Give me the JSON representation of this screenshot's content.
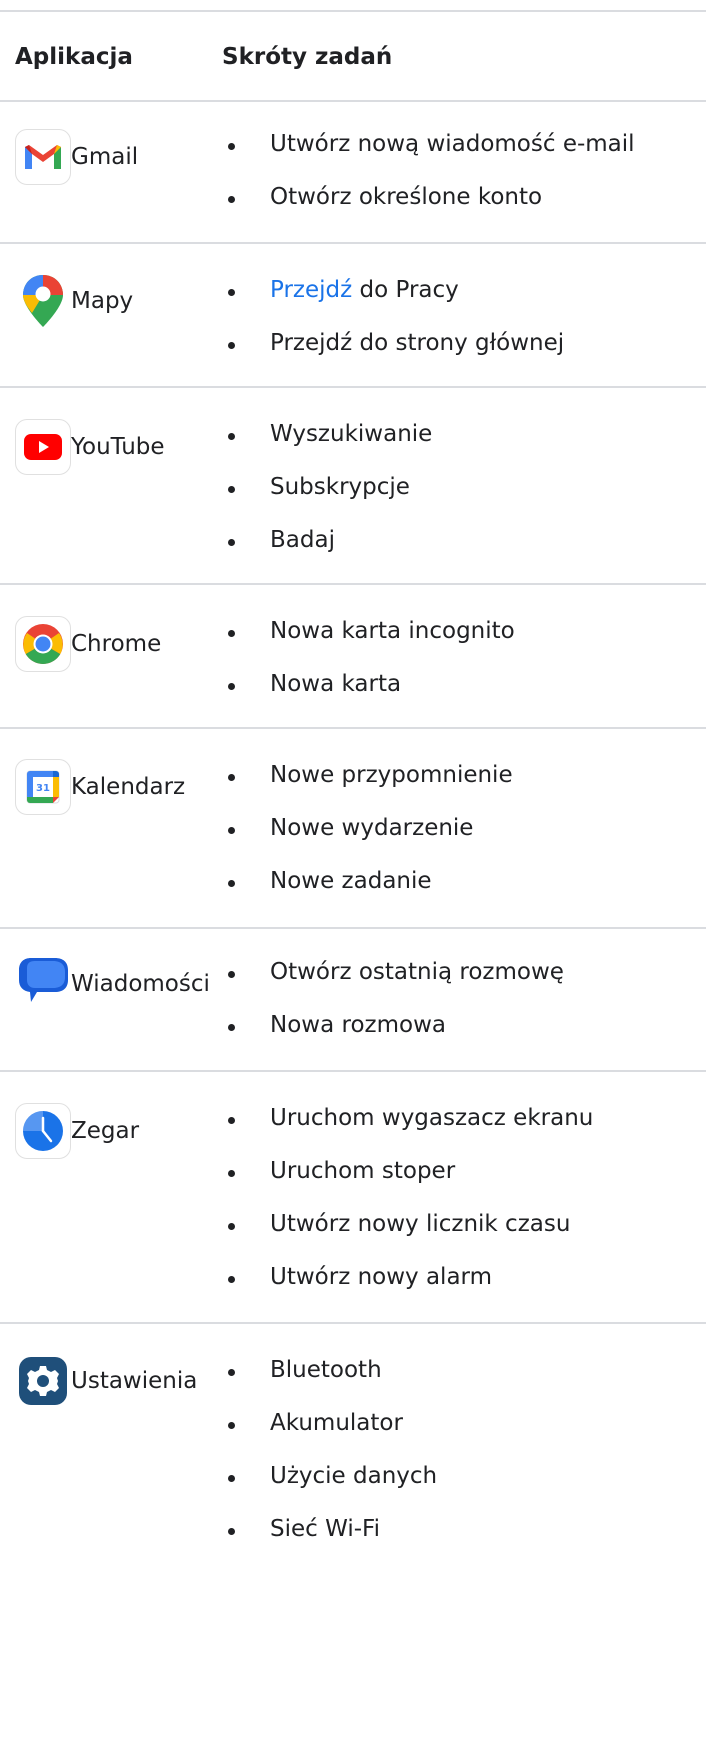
{
  "table": {
    "header": {
      "app_col": "Aplikacja",
      "shortcuts_col": "Skróty zadań"
    },
    "rows": [
      {
        "app": "Gmail",
        "icon": "gmail-icon",
        "shortcuts": [
          "Utwórz nową wiadomość e-mail",
          "Otwórz określone konto"
        ]
      },
      {
        "app": "Mapy",
        "icon": "maps-icon",
        "shortcuts": [
          "Przejdź",
          " do Pracy",
          "Przejdź do strony głównej"
        ],
        "link_word": "Przejdź",
        "link_rest": " do Pracy"
      },
      {
        "app": "YouTube",
        "icon": "youtube-icon",
        "shortcuts": [
          "Wyszukiwanie",
          "Subskrypcje",
          "Badaj"
        ]
      },
      {
        "app": "Chrome",
        "icon": "chrome-icon",
        "shortcuts": [
          "Nowa karta incognito",
          "Nowa karta"
        ]
      },
      {
        "app": "Kalendarz",
        "icon": "calendar-icon",
        "calendar_day": "31",
        "shortcuts": [
          "Nowe przypomnienie",
          "Nowe wydarzenie",
          "Nowe zadanie"
        ]
      },
      {
        "app": "Wiadomości",
        "icon": "messages-icon",
        "shortcuts": [
          "Otwórz ostatnią rozmowę",
          "Nowa rozmowa"
        ]
      },
      {
        "app": "Zegar",
        "icon": "clock-icon",
        "shortcuts": [
          "Uruchom wygaszacz ekranu",
          "Uruchom stoper",
          "Utwórz nowy licznik czasu",
          "Utwórz nowy alarm"
        ]
      },
      {
        "app": "Ustawienia",
        "icon": "settings-icon",
        "shortcuts": [
          "Bluetooth",
          "Akumulator",
          "Użycie danych",
          "Sieć Wi-Fi"
        ]
      }
    ]
  },
  "colors": {
    "text": "#202124",
    "link": "#1a73e8",
    "divider": "#dadce0"
  }
}
